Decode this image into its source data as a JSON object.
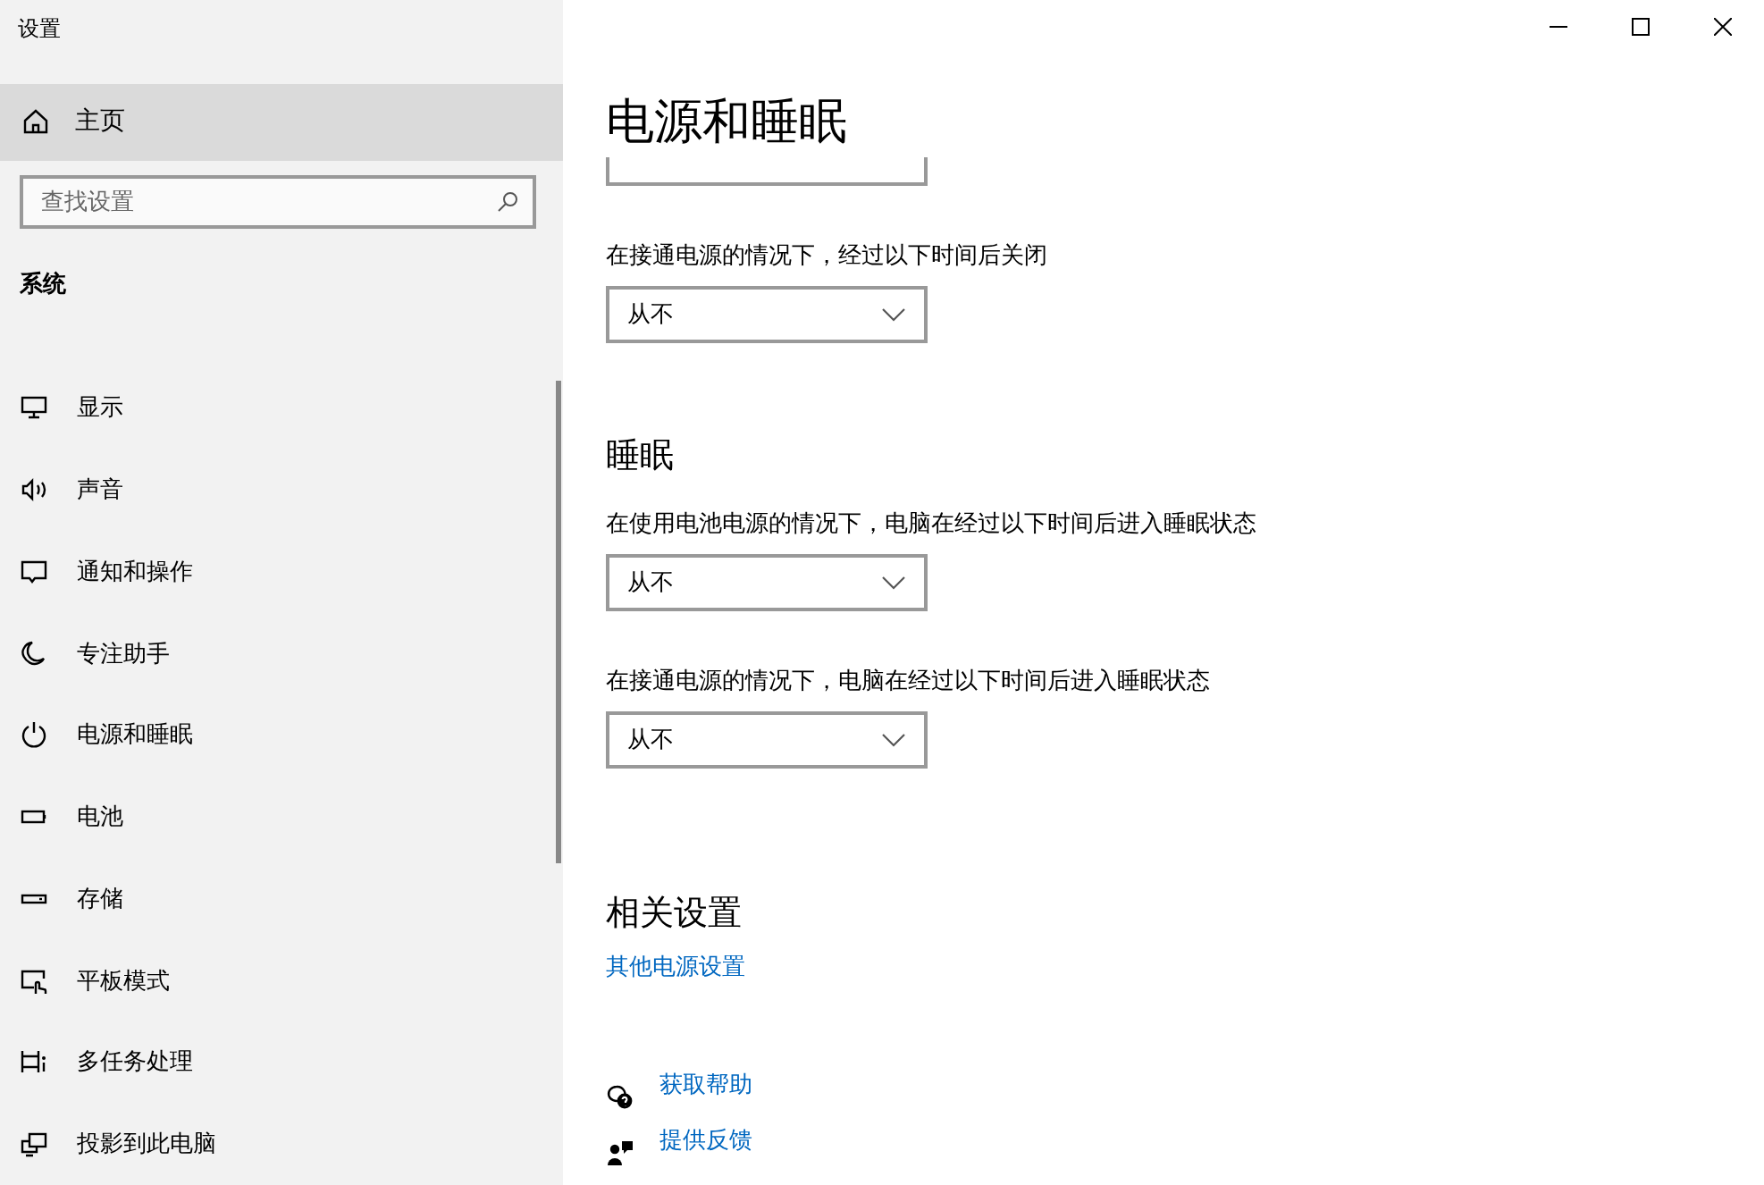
{
  "window": {
    "title": "设置"
  },
  "sidebar": {
    "home": {
      "label": "主页",
      "highlighted": true
    },
    "search": {
      "placeholder": "查找设置"
    },
    "section": "系统",
    "items": [
      {
        "label": "显示"
      },
      {
        "label": "声音"
      },
      {
        "label": "通知和操作"
      },
      {
        "label": "专注助手"
      },
      {
        "label": "电源和睡眠"
      },
      {
        "label": "电池"
      },
      {
        "label": "存储"
      },
      {
        "label": "平板模式"
      },
      {
        "label": "多任务处理"
      },
      {
        "label": "投影到此电脑"
      }
    ]
  },
  "main": {
    "title": "电源和睡眠",
    "screen_settings": [
      {
        "kind": "partial"
      },
      {
        "kind": "full",
        "label": "在接通电源的情况下，经过以下时间后关闭",
        "value": "从不"
      }
    ],
    "sleep": {
      "heading": "睡眠",
      "settings": [
        {
          "label": "在使用电池电源的情况下，电脑在经过以下时间后进入睡眠状态",
          "value": "从不"
        },
        {
          "label": "在接通电源的情况下，电脑在经过以下时间后进入睡眠状态",
          "value": "从不"
        }
      ]
    },
    "related": {
      "heading": "相关设置",
      "links": [
        "其他电源设置"
      ]
    },
    "help_links": [
      {
        "label": "获取帮助"
      },
      {
        "label": "提供反馈"
      }
    ]
  }
}
